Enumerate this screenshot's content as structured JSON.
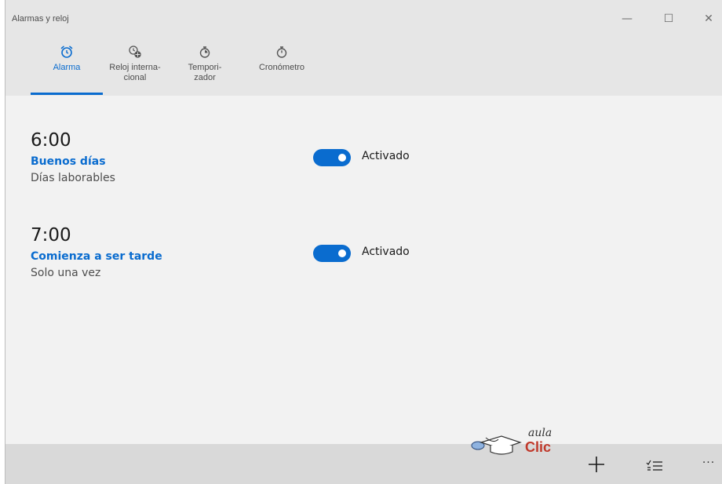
{
  "window": {
    "title": "Alarmas y reloj",
    "controls": {
      "minimize": "—",
      "maximize": "☐",
      "close": "✕"
    }
  },
  "tabs": [
    {
      "line1": "Alarma",
      "line2": "",
      "icon": "alarm-clock-icon",
      "active": true
    },
    {
      "line1": "Reloj interna-",
      "line2": "cional",
      "icon": "world-clock-icon",
      "active": false
    },
    {
      "line1": "Tempori-",
      "line2": "zador",
      "icon": "timer-icon",
      "active": false
    },
    {
      "line1": "Cronómetro",
      "line2": "",
      "icon": "stopwatch-icon",
      "active": false
    }
  ],
  "alarms": [
    {
      "time": "6:00",
      "name": "Buenos días",
      "repeat": "Días laborables",
      "toggle_state": "Activado",
      "enabled": true
    },
    {
      "time": "7:00",
      "name": "Comienza a ser tarde",
      "repeat": "Solo una vez",
      "toggle_state": "Activado",
      "enabled": true
    }
  ],
  "commands": {
    "add_icon": "plus-icon",
    "select_icon": "select-list-icon",
    "more": "···"
  },
  "watermark": {
    "line1": "aula",
    "line2": "Clic"
  },
  "colors": {
    "accent": "#0a6ccf",
    "background": "#f2f2f2",
    "header": "#e6e6e6",
    "commandbar": "#d9d9d9",
    "brand_red": "#c0392b"
  }
}
